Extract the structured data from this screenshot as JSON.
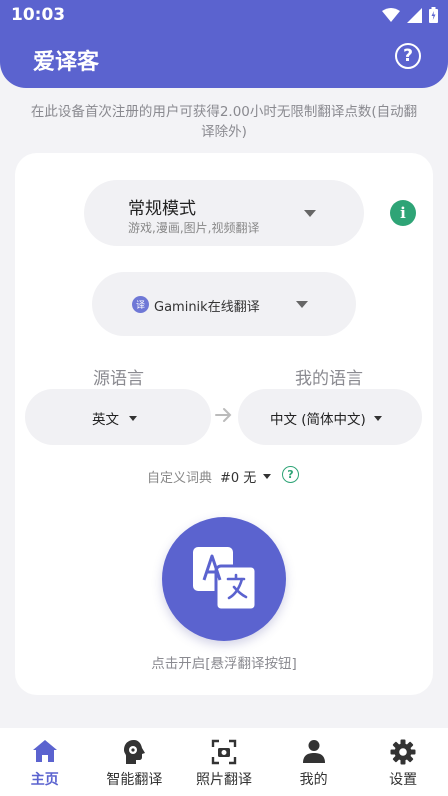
{
  "status_bar": {
    "time": "10:03"
  },
  "header": {
    "title": "爱译客"
  },
  "notice": "在此设备首次注册的用户可获得2.00小时无限制翻译点数(自动翻译除外)",
  "mode": {
    "title": "常规模式",
    "subtitle": "游戏,漫画,图片,视频翻译"
  },
  "engine": {
    "label": "Gaminik在线翻译"
  },
  "languages": {
    "source_heading": "源语言",
    "target_heading": "我的语言",
    "source_value": "英文",
    "target_value": "中文 (简体中文)"
  },
  "dictionary": {
    "label": "自定义词典",
    "value": "#0 无"
  },
  "float_button": {
    "hint": "点击开启[悬浮翻译按钮]"
  },
  "nav": [
    {
      "label": "主页",
      "icon": "home-icon",
      "active": true
    },
    {
      "label": "智能翻译",
      "icon": "ai-head-icon",
      "active": false
    },
    {
      "label": "照片翻译",
      "icon": "photo-scan-icon",
      "active": false
    },
    {
      "label": "我的",
      "icon": "person-icon",
      "active": false
    },
    {
      "label": "设置",
      "icon": "gear-icon",
      "active": false
    }
  ],
  "colors": {
    "primary": "#5b63cf",
    "accent_green": "#2ea476",
    "background": "#f3f3f6"
  }
}
